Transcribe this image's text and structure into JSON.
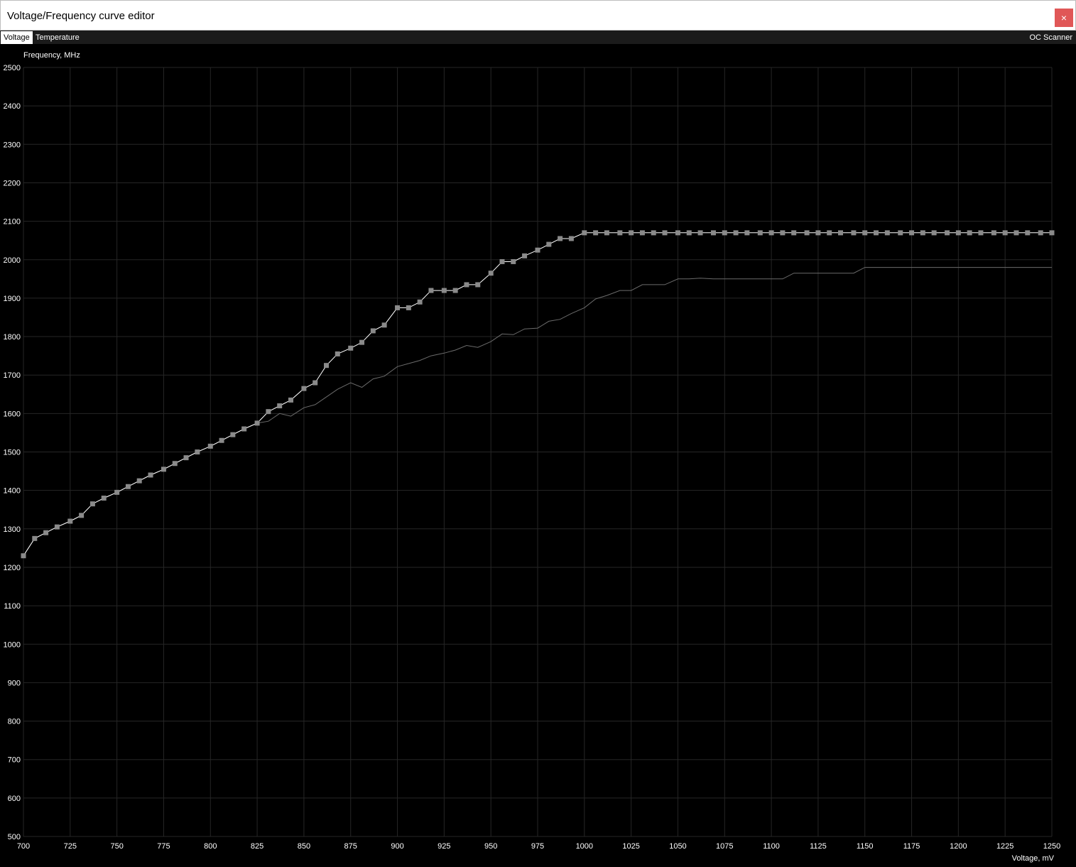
{
  "window": {
    "title": "Voltage/Frequency curve editor",
    "close_glyph": "×",
    "close_color": "#e05757"
  },
  "tabs": [
    {
      "label": "Voltage",
      "active": true
    },
    {
      "label": "Temperature",
      "active": false
    }
  ],
  "oc_scanner_label": "OC Scanner",
  "chart_data": {
    "type": "line",
    "ylabel": "Frequency, MHz",
    "xlabel": "Voltage, mV",
    "xlim": [
      700,
      1250
    ],
    "ylim": [
      500,
      2500
    ],
    "x_ticks": [
      700,
      725,
      750,
      775,
      800,
      825,
      850,
      875,
      900,
      925,
      950,
      975,
      1000,
      1025,
      1050,
      1075,
      1100,
      1125,
      1150,
      1175,
      1200,
      1225,
      1250
    ],
    "y_ticks": [
      500,
      600,
      700,
      800,
      900,
      1000,
      1100,
      1200,
      1300,
      1400,
      1500,
      1600,
      1700,
      1800,
      1900,
      2000,
      2100,
      2200,
      2300,
      2400,
      2500
    ],
    "grid": true,
    "background": "#000000",
    "series": [
      {
        "role": "curve",
        "color": "#ffffff",
        "markers": true,
        "points": [
          [
            700,
            1230
          ],
          [
            706,
            1275
          ],
          [
            712,
            1290
          ],
          [
            718,
            1305
          ],
          [
            725,
            1320
          ],
          [
            731,
            1335
          ],
          [
            737,
            1365
          ],
          [
            743,
            1380
          ],
          [
            750,
            1395
          ],
          [
            756,
            1410
          ],
          [
            762,
            1425
          ],
          [
            768,
            1440
          ],
          [
            775,
            1455
          ],
          [
            781,
            1470
          ],
          [
            787,
            1485
          ],
          [
            793,
            1500
          ],
          [
            800,
            1515
          ],
          [
            806,
            1530
          ],
          [
            812,
            1545
          ],
          [
            818,
            1560
          ],
          [
            825,
            1575
          ],
          [
            831,
            1605
          ],
          [
            837,
            1620
          ],
          [
            843,
            1635
          ],
          [
            850,
            1665
          ],
          [
            856,
            1680
          ],
          [
            862,
            1725
          ],
          [
            868,
            1755
          ],
          [
            875,
            1770
          ],
          [
            881,
            1785
          ],
          [
            887,
            1815
          ],
          [
            893,
            1830
          ],
          [
            900,
            1875
          ],
          [
            906,
            1875
          ],
          [
            912,
            1890
          ],
          [
            918,
            1920
          ],
          [
            925,
            1920
          ],
          [
            931,
            1920
          ],
          [
            937,
            1935
          ],
          [
            943,
            1935
          ],
          [
            950,
            1965
          ],
          [
            956,
            1995
          ],
          [
            962,
            1995
          ],
          [
            968,
            2010
          ],
          [
            975,
            2025
          ],
          [
            981,
            2040
          ],
          [
            987,
            2055
          ],
          [
            993,
            2055
          ],
          [
            1000,
            2070
          ],
          [
            1006,
            2070
          ],
          [
            1012,
            2070
          ],
          [
            1019,
            2070
          ],
          [
            1025,
            2070
          ],
          [
            1031,
            2070
          ],
          [
            1037,
            2070
          ],
          [
            1043,
            2070
          ],
          [
            1050,
            2070
          ],
          [
            1056,
            2070
          ],
          [
            1062,
            2070
          ],
          [
            1069,
            2070
          ],
          [
            1075,
            2070
          ],
          [
            1081,
            2070
          ],
          [
            1087,
            2070
          ],
          [
            1094,
            2070
          ],
          [
            1100,
            2070
          ],
          [
            1106,
            2070
          ],
          [
            1112,
            2070
          ],
          [
            1119,
            2070
          ],
          [
            1125,
            2070
          ],
          [
            1131,
            2070
          ],
          [
            1137,
            2070
          ],
          [
            1144,
            2070
          ],
          [
            1150,
            2070
          ],
          [
            1156,
            2070
          ],
          [
            1162,
            2070
          ],
          [
            1169,
            2070
          ],
          [
            1175,
            2070
          ],
          [
            1181,
            2070
          ],
          [
            1187,
            2070
          ],
          [
            1194,
            2070
          ],
          [
            1200,
            2070
          ],
          [
            1206,
            2070
          ],
          [
            1212,
            2070
          ],
          [
            1219,
            2070
          ],
          [
            1225,
            2070
          ],
          [
            1231,
            2070
          ],
          [
            1237,
            2070
          ],
          [
            1244,
            2070
          ],
          [
            1250,
            2070
          ]
        ]
      },
      {
        "role": "reference",
        "color": "#6b6b6b",
        "markers": false,
        "points": [
          [
            700,
            1230
          ],
          [
            706,
            1275
          ],
          [
            712,
            1290
          ],
          [
            718,
            1305
          ],
          [
            725,
            1320
          ],
          [
            731,
            1335
          ],
          [
            737,
            1365
          ],
          [
            743,
            1380
          ],
          [
            750,
            1395
          ],
          [
            756,
            1410
          ],
          [
            762,
            1425
          ],
          [
            768,
            1440
          ],
          [
            775,
            1455
          ],
          [
            781,
            1470
          ],
          [
            787,
            1485
          ],
          [
            793,
            1500
          ],
          [
            800,
            1515
          ],
          [
            806,
            1530
          ],
          [
            812,
            1545
          ],
          [
            818,
            1560
          ],
          [
            825,
            1575
          ],
          [
            831,
            1580
          ],
          [
            837,
            1600
          ],
          [
            843,
            1593
          ],
          [
            850,
            1615
          ],
          [
            856,
            1623
          ],
          [
            862,
            1643
          ],
          [
            868,
            1663
          ],
          [
            875,
            1680
          ],
          [
            881,
            1668
          ],
          [
            887,
            1690
          ],
          [
            893,
            1697
          ],
          [
            900,
            1722
          ],
          [
            906,
            1730
          ],
          [
            912,
            1738
          ],
          [
            918,
            1750
          ],
          [
            925,
            1757
          ],
          [
            931,
            1765
          ],
          [
            937,
            1777
          ],
          [
            943,
            1772
          ],
          [
            950,
            1787
          ],
          [
            956,
            1807
          ],
          [
            962,
            1805
          ],
          [
            968,
            1820
          ],
          [
            975,
            1822
          ],
          [
            981,
            1840
          ],
          [
            987,
            1845
          ],
          [
            993,
            1860
          ],
          [
            1000,
            1875
          ],
          [
            1006,
            1898
          ],
          [
            1012,
            1907
          ],
          [
            1019,
            1920
          ],
          [
            1025,
            1920
          ],
          [
            1031,
            1935
          ],
          [
            1037,
            1935
          ],
          [
            1043,
            1935
          ],
          [
            1050,
            1950
          ],
          [
            1056,
            1950
          ],
          [
            1062,
            1952
          ],
          [
            1069,
            1950
          ],
          [
            1075,
            1950
          ],
          [
            1081,
            1950
          ],
          [
            1087,
            1950
          ],
          [
            1094,
            1950
          ],
          [
            1100,
            1950
          ],
          [
            1106,
            1950
          ],
          [
            1112,
            1965
          ],
          [
            1119,
            1965
          ],
          [
            1125,
            1965
          ],
          [
            1131,
            1965
          ],
          [
            1137,
            1965
          ],
          [
            1144,
            1965
          ],
          [
            1150,
            1980
          ],
          [
            1156,
            1980
          ],
          [
            1162,
            1980
          ],
          [
            1169,
            1980
          ],
          [
            1175,
            1980
          ],
          [
            1181,
            1980
          ],
          [
            1187,
            1980
          ],
          [
            1194,
            1980
          ],
          [
            1200,
            1980
          ],
          [
            1206,
            1980
          ],
          [
            1212,
            1980
          ],
          [
            1219,
            1980
          ],
          [
            1225,
            1980
          ],
          [
            1231,
            1980
          ],
          [
            1237,
            1980
          ],
          [
            1244,
            1980
          ],
          [
            1250,
            1980
          ]
        ]
      }
    ]
  }
}
